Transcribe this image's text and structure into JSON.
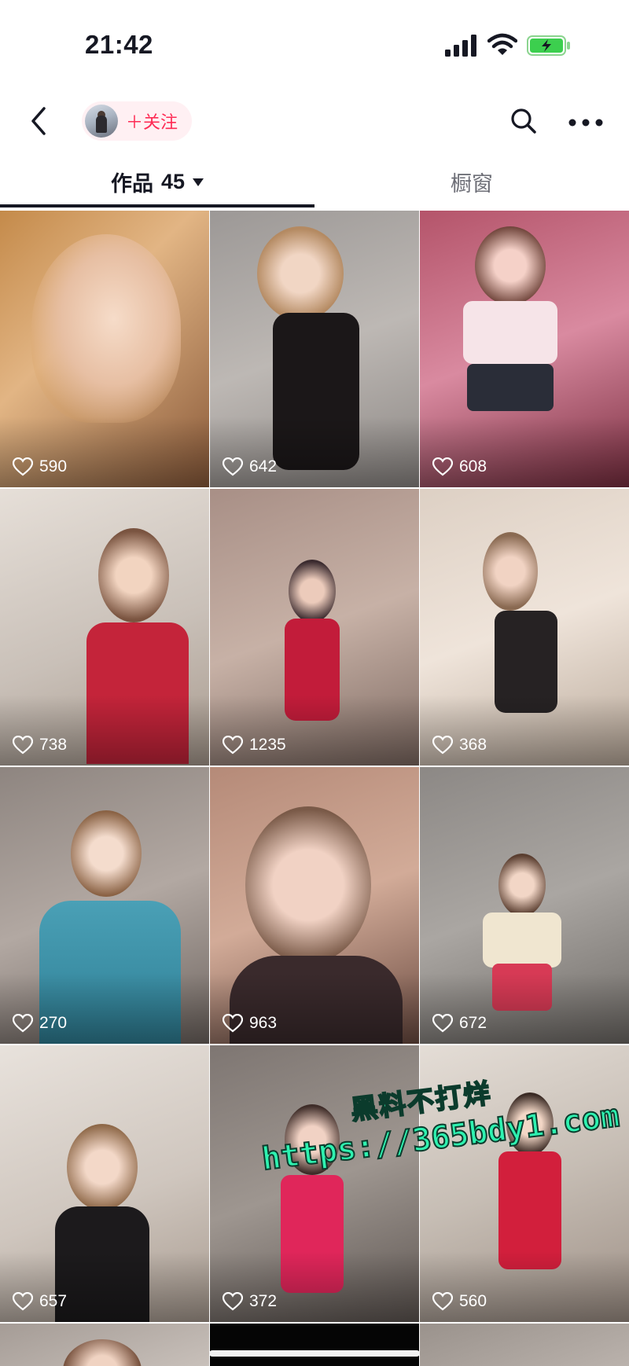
{
  "status_bar": {
    "time": "21:42"
  },
  "nav": {
    "follow_label": "＋关注"
  },
  "tabs": {
    "works_label": "作品",
    "works_count": "45",
    "window_label": "橱窗"
  },
  "videos": [
    {
      "likes": "590"
    },
    {
      "likes": "642"
    },
    {
      "likes": "608"
    },
    {
      "likes": "738"
    },
    {
      "likes": "1235"
    },
    {
      "likes": "368"
    },
    {
      "likes": "270"
    },
    {
      "likes": "963"
    },
    {
      "likes": "672"
    },
    {
      "likes": "657"
    },
    {
      "likes": "372"
    },
    {
      "likes": "560"
    },
    {
      "likes": ""
    },
    {
      "likes": ""
    },
    {
      "likes": ""
    }
  ],
  "watermark": {
    "line1": "黑料不打烊",
    "line2": "https://365bdy1.com"
  },
  "colors": {
    "accent": "#fe2c55",
    "text": "#161823",
    "watermark": "#2ef2b0"
  },
  "icons": [
    "back-icon",
    "search-icon",
    "more-icon",
    "heart-icon",
    "signal-icon",
    "wifi-icon",
    "battery-icon"
  ]
}
